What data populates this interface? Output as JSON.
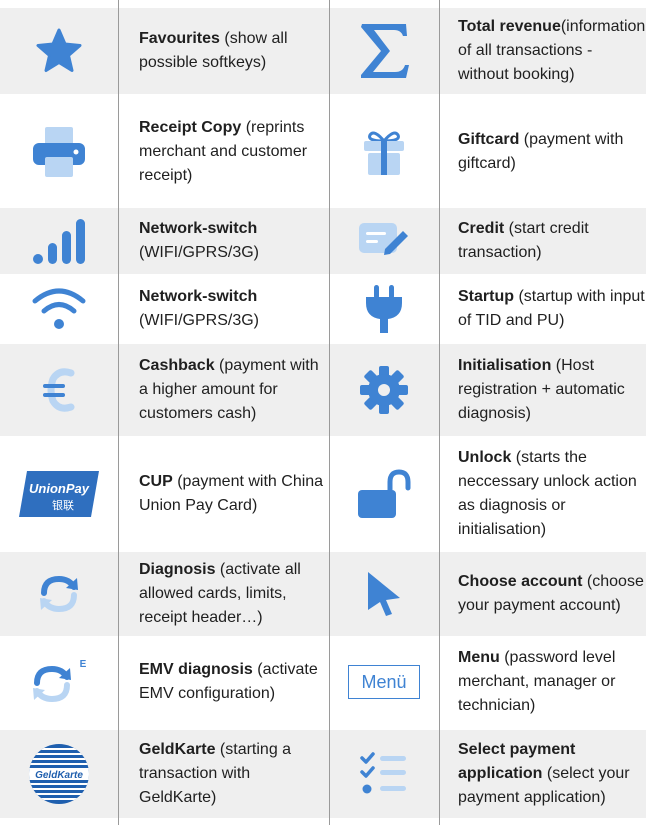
{
  "colors": {
    "icon_dark": "#3f83d3",
    "icon_light": "#b9d5f3",
    "shade": "#efefef",
    "divider": "#9a9a9a"
  },
  "rows": [
    {
      "left": {
        "icon": "star-icon",
        "title": "Favourites",
        "desc": " (show all possible softkeys)"
      },
      "right": {
        "icon": "sigma-icon",
        "title": "Total revenue",
        "desc": "(information of all transactions - without booking)"
      }
    },
    {
      "left": {
        "icon": "printer-icon",
        "title": "Receipt Copy",
        "desc": " (reprints merchant and customer receipt)"
      },
      "right": {
        "icon": "gift-icon",
        "title": "Giftcard",
        "desc": " (payment with giftcard)"
      }
    },
    {
      "left": {
        "icon": "signal-bars-icon",
        "title": "Network-switch",
        "desc": " (WIFI/GPRS/3G)"
      },
      "right": {
        "icon": "credit-edit-icon",
        "title": "Credit",
        "desc": " (start credit transaction)"
      }
    },
    {
      "left": {
        "icon": "wifi-icon",
        "title": "Network-switch",
        "desc": " (WIFI/GPRS/3G)"
      },
      "right": {
        "icon": "plug-icon",
        "title": "Startup",
        "desc": " (startup with input of TID and PU)"
      }
    },
    {
      "left": {
        "icon": "euro-icon",
        "title": "Cashback",
        "desc": " (payment with a higher amount for customers cash)"
      },
      "right": {
        "icon": "gear-icon",
        "title": "Initialisation",
        "desc": " (Host registration + automatic diagnosis)"
      }
    },
    {
      "left": {
        "icon": "unionpay-logo-icon",
        "title": "CUP",
        "desc": " (payment with China Union Pay Card)",
        "logo_text": "UnionPay",
        "logo_sub": "银联"
      },
      "right": {
        "icon": "unlock-icon",
        "title": "Unlock",
        "desc": " (starts the neccessary unlock action as diagnosis or initialisation)"
      }
    },
    {
      "left": {
        "icon": "refresh-icon",
        "title": "Diagnosis",
        "desc": " (activate all allowed cards, limits, receipt header…)"
      },
      "right": {
        "icon": "cursor-icon",
        "title": "Choose account",
        "desc": " (choose your payment account)"
      }
    },
    {
      "left": {
        "icon": "refresh-e-icon",
        "title": "EMV diagnosis",
        "desc": " (activate EMV configuration)",
        "badge": "E"
      },
      "right": {
        "icon": "menu-button-icon",
        "title": "Menu",
        "desc": " (password level merchant, manager or technician)",
        "button_label": "Menü"
      }
    },
    {
      "left": {
        "icon": "geldkarte-logo-icon",
        "title": "GeldKarte",
        "desc": " (starting a transaction with GeldKarte)",
        "logo_text": "GeldKarte"
      },
      "right": {
        "icon": "checklist-icon",
        "title": "Select payment application",
        "desc": " (select your payment application)"
      }
    }
  ]
}
